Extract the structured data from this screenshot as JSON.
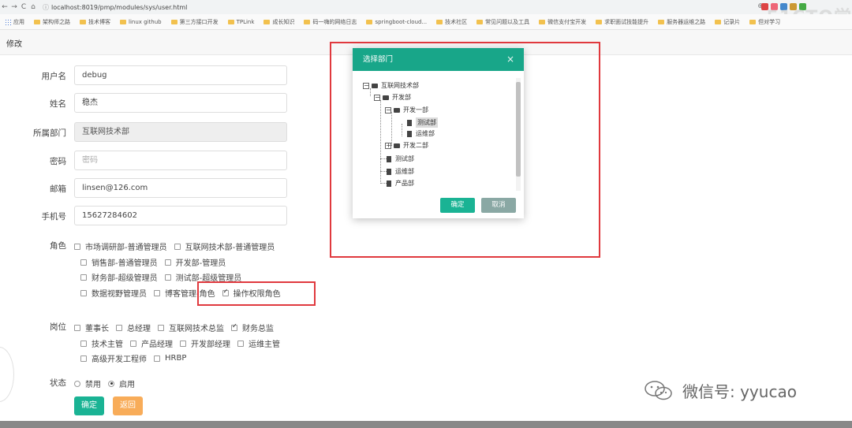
{
  "browser": {
    "url": "localhost:8019/pmp/modules/sys/user.html",
    "bookmarks": [
      "应用",
      "架构师之路",
      "技术博客",
      "linux github",
      "第三方接口开发",
      "TPLink",
      "成长知识",
      "码一嗨的网络日志",
      "springboot-cloud...",
      "技术社区",
      "常见问题以及工具",
      "微信支付宝开发",
      "求职面试技能提升",
      "服务器运维之路",
      "记录片",
      "但对学习"
    ],
    "watermark": "51CTO学"
  },
  "tab": {
    "label": "修改"
  },
  "form": {
    "username": {
      "label": "用户名",
      "value": "debug"
    },
    "name": {
      "label": "姓名",
      "value": "稳杰"
    },
    "dept": {
      "label": "所属部门",
      "value": "互联网技术部"
    },
    "password": {
      "label": "密码",
      "placeholder": "密码"
    },
    "email": {
      "label": "邮箱",
      "value": "linsen@126.com"
    },
    "phone": {
      "label": "手机号",
      "value": "15627284602"
    },
    "roles": {
      "label": "角色",
      "rows": [
        [
          {
            "text": "市场调研部-普通管理员",
            "checked": false
          },
          {
            "text": "互联网技术部-普通管理员",
            "checked": false
          }
        ],
        [
          {
            "text": "销售部-普通管理员",
            "checked": false
          },
          {
            "text": "开发部-管理员",
            "checked": false
          }
        ],
        [
          {
            "text": "财务部-超级管理员",
            "checked": false
          },
          {
            "text": "测试部-超级管理员",
            "checked": false
          }
        ],
        [
          {
            "text": "数据视野管理员",
            "checked": false
          },
          {
            "text": "博客管理-角色",
            "checked": false
          },
          {
            "text": "操作权限角色",
            "checked": true
          }
        ]
      ]
    },
    "positions": {
      "label": "岗位",
      "rows": [
        [
          {
            "text": "董事长",
            "checked": false
          },
          {
            "text": "总经理",
            "checked": false
          },
          {
            "text": "互联网技术总监",
            "checked": false
          },
          {
            "text": "财务总监",
            "checked": true
          }
        ],
        [
          {
            "text": "技术主管",
            "checked": false
          },
          {
            "text": "产品经理",
            "checked": false
          },
          {
            "text": "开发部经理",
            "checked": false
          },
          {
            "text": "运维主管",
            "checked": false
          }
        ],
        [
          {
            "text": "高级开发工程师",
            "checked": false
          },
          {
            "text": "HRBP",
            "checked": false
          }
        ]
      ]
    },
    "status": {
      "label": "状态",
      "options": [
        {
          "text": "禁用",
          "checked": false
        },
        {
          "text": "启用",
          "checked": true
        }
      ]
    },
    "confirm_label": "确定",
    "back_label": "返回"
  },
  "modal": {
    "title": "选择部门",
    "close": "×",
    "tree": {
      "root": "互联网技术部",
      "dev": "开发部",
      "dev1": "开发一部",
      "dev1_a": "测试部",
      "dev1_b": "运维部",
      "dev2": "开发二部",
      "test": "测试部",
      "ops": "运维部",
      "product": "产品部"
    },
    "ok_label": "确定",
    "cancel_label": "取消"
  },
  "wechat": {
    "text": "微信号: yyucao"
  },
  "colors": {
    "teal": "#1ab394",
    "orange": "#f8ac59",
    "highlight_red": "#e0393e"
  }
}
